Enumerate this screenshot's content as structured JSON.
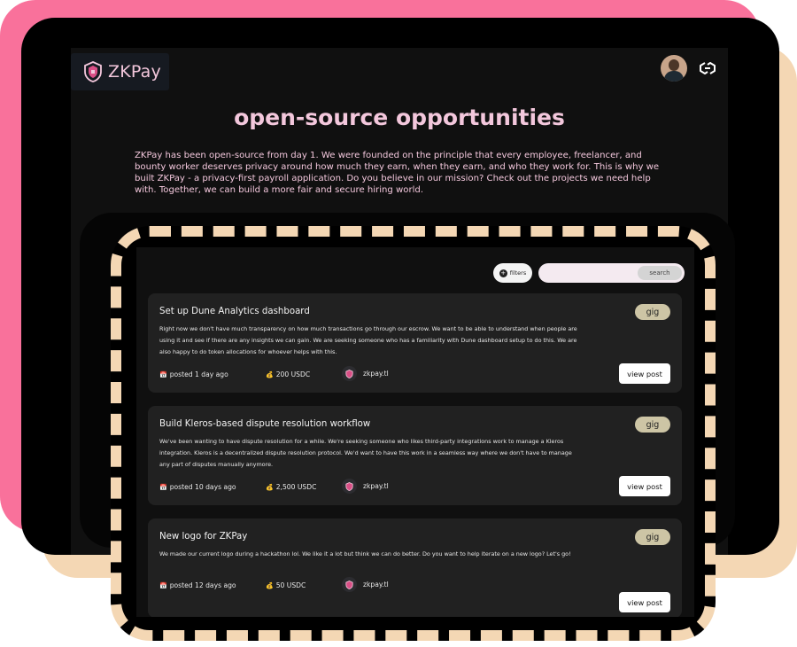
{
  "brand": {
    "name": "ZKPay",
    "accent": "#f3c7dc",
    "logo_icon": "shield-icon"
  },
  "header": {
    "profile_icon": "avatar",
    "wallet_icon": "chain-link-icon"
  },
  "page": {
    "title": "open-source opportunities",
    "description": "ZKPay has been open-source from day 1. We were founded on the principle that every employee, freelancer, and bounty worker deserves privacy around how much they earn, when they earn, and who they work for. This is why we built ZKPay - a privacy-first payroll application. Do you believe in our mission? Check out the projects we need help with. Together, we can build a more fair and secure hiring world."
  },
  "toolbar": {
    "filters_label": "filters",
    "search_placeholder": "",
    "search_button": "search"
  },
  "jobs": [
    {
      "title": "Set up Dune Analytics dashboard",
      "tag": "gig",
      "description": "Right now we don't have much transparency on how much transactions go through our escrow. We want to be able to understand when people are using it and see if there are any insights we can gain. We are seeking someone who has a familiarity with Dune dashboard setup to do this. We are also happy to do token allocations for whoever helps with this.",
      "posted": "posted 1 day ago",
      "bounty": "200 USDC",
      "org": "zkpay.tl",
      "action": "view post"
    },
    {
      "title": "Build Kleros-based dispute resolution workflow",
      "tag": "gig",
      "description": "We've been wanting to have dispute resolution for a while. We're seeking someone who likes third-party integrations work to manage a Kleros integration. Kleros is a decentralized dispute resolution protocol. We'd want to have this work in a seamless way where we don't have to manage any part of disputes manually anymore.",
      "posted": "posted 10 days ago",
      "bounty": "2,500 USDC",
      "org": "zkpay.tl",
      "action": "view post"
    },
    {
      "title": "New logo for ZKPay",
      "tag": "gig",
      "description": "We made our current logo during a hackathon lol. We like it a lot but think we can do better. Do you want to help iterate on a new logo? Let's go!",
      "posted": "posted 12 days ago",
      "bounty": "50 USDC",
      "org": "zkpay.tl",
      "action": "view post"
    }
  ],
  "colors": {
    "pink_frame": "#f9719b",
    "peach_frame": "#f4d7b4",
    "tag_bg": "#cdc5a5",
    "card_bg": "#212121"
  }
}
